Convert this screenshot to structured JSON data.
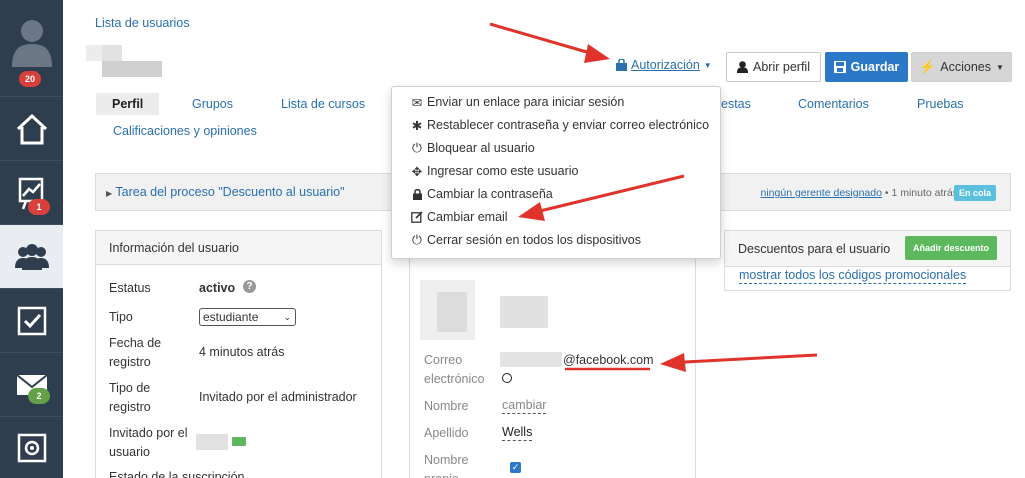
{
  "sidebar": {
    "user_badge": "20",
    "messages_badge": "2",
    "tasks_badge": "1"
  },
  "header": {
    "breadcrumb": "Lista de usuarios",
    "auth_label": "Autorización",
    "open_profile": "Abrir perfil",
    "save": "Guardar",
    "actions": "Acciones"
  },
  "tabs": [
    "Perfil",
    "Grupos",
    "Lista de cursos",
    "estas",
    "Comentarios",
    "Pruebas",
    "Calificaciones y opiniones"
  ],
  "auth_menu": [
    {
      "icon": "envelope-icon",
      "label": "Enviar un enlace para iniciar sesión"
    },
    {
      "icon": "asterisk-icon",
      "label": "Restablecer contraseña y enviar correo electrónico"
    },
    {
      "icon": "power-icon",
      "label": "Bloquear al usuario"
    },
    {
      "icon": "move-icon",
      "label": "Ingresar como este usuario"
    },
    {
      "icon": "lock-icon",
      "label": "Cambiar la contraseña"
    },
    {
      "icon": "edit-icon",
      "label": "Cambiar email"
    },
    {
      "icon": "power-icon",
      "label": "Cerrar sesión en todos los dispositivos"
    }
  ],
  "process": {
    "title": "Tarea del proceso \"Descuento al usuario\"",
    "manager": "ningún gerente designado",
    "time": "• 1 minuto atrás",
    "status": "En cola"
  },
  "user_info": {
    "title": "Información del usuario",
    "status_label": "Estatus",
    "status_value": "activo",
    "type_label": "Tipo",
    "type_value": "estudiante",
    "reg_date_label_1": "Fecha de",
    "reg_date_label_2": "registro",
    "reg_date_value": "4 minutos atrás",
    "reg_type_label_1": "Tipo de",
    "reg_type_label_2": "registro",
    "reg_type_value": "Invitado por el administrador",
    "invited_label_1": "Invitado por el",
    "invited_label_2": "usuario",
    "subscription_label": "Estado de la suscripción"
  },
  "profile": {
    "email_label_1": "Correo",
    "email_label_2": "electrónico",
    "email_domain": "@facebook.com",
    "name_label": "Nombre",
    "name_value": "cambiar",
    "lastname_label": "Apellido",
    "lastname_value": "Wells",
    "own_name_label_1": "Nombre",
    "own_name_label_2": "propio"
  },
  "discounts": {
    "title": "Descuentos para el usuario",
    "add_button": "Añadir descuento",
    "show_all": "mostrar todos los códigos promocionales"
  },
  "colors": {
    "sidebar_bg": "#2f3e4e",
    "link": "#2a6fb0",
    "primary": "#2a78c6",
    "success": "#5cb85c",
    "info": "#5bc0de",
    "annotation_arrow": "#e0332b"
  }
}
